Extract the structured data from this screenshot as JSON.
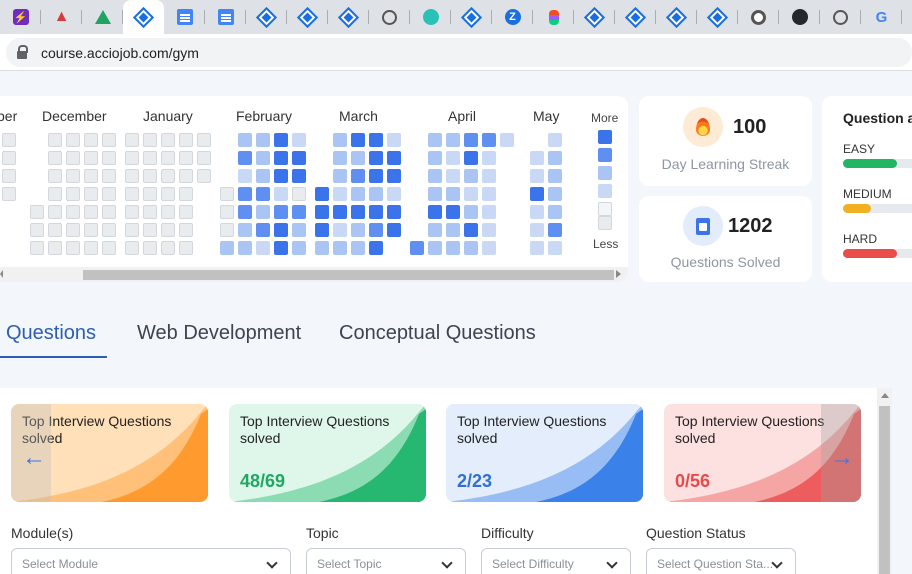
{
  "browser": {
    "url": "course.acciojob.com/gym",
    "tabs": [
      "bolt",
      "acrobat",
      "drive",
      "diamond",
      "docs",
      "docs",
      "diamond",
      "diamond",
      "diamond",
      "globe",
      "teal",
      "diamond",
      "z",
      "figma",
      "diamond",
      "diamond",
      "diamond",
      "diamond",
      "chrome",
      "github",
      "globe",
      "google",
      "globe"
    ]
  },
  "heatmap": {
    "months": [
      "ber",
      "December",
      "January",
      "February",
      "March",
      "April",
      "May"
    ],
    "more_label": "More",
    "less_label": "Less"
  },
  "stats": {
    "streak": {
      "value": "100",
      "label": "Day Learning Streak",
      "icon": "fire-icon"
    },
    "solved": {
      "value": "1202",
      "label": "Questions Solved",
      "icon": "clipboard-icon"
    }
  },
  "difficulty": {
    "title": "Question an",
    "items": [
      {
        "label": "EASY",
        "color": "#22b564",
        "fraction": 0.6
      },
      {
        "label": "MEDIUM",
        "color": "#f2b01e",
        "fraction": 0.31
      },
      {
        "label": "HARD",
        "color": "#ea4b4b",
        "fraction": 0.6
      }
    ]
  },
  "tabs": [
    {
      "label": "Questions",
      "active": true
    },
    {
      "label": "Web Development",
      "active": false
    },
    {
      "label": "Conceptual Questions",
      "active": false
    }
  ],
  "question_cards": [
    {
      "title": "Top Interview Questions solved",
      "value": "",
      "bg": "#ffe0b8",
      "accent": "#ff9a2e",
      "value_color": "#ff8a1e"
    },
    {
      "title": "Top Interview Questions solved",
      "value": "48/69",
      "bg": "#dff7ea",
      "accent": "#26b871",
      "value_color": "#1fa860"
    },
    {
      "title": "Top Interview Questions solved",
      "value": "2/23",
      "bg": "#e3edfb",
      "accent": "#3a82ea",
      "value_color": "#2f6fd8"
    },
    {
      "title": "Top Interview Questions solved",
      "value": "0/56",
      "bg": "#fde0e0",
      "accent": "#ee5d5d",
      "value_color": "#e84a4a"
    }
  ],
  "filters": [
    {
      "label": "Module(s)",
      "placeholder": "Select Module"
    },
    {
      "label": "Topic",
      "placeholder": "Select Topic"
    },
    {
      "label": "Difficulty",
      "placeholder": "Select Difficulty"
    },
    {
      "label": "Question Status",
      "placeholder": "Select Question Sta..."
    }
  ],
  "nav": {
    "prev": "←",
    "next": "→"
  }
}
